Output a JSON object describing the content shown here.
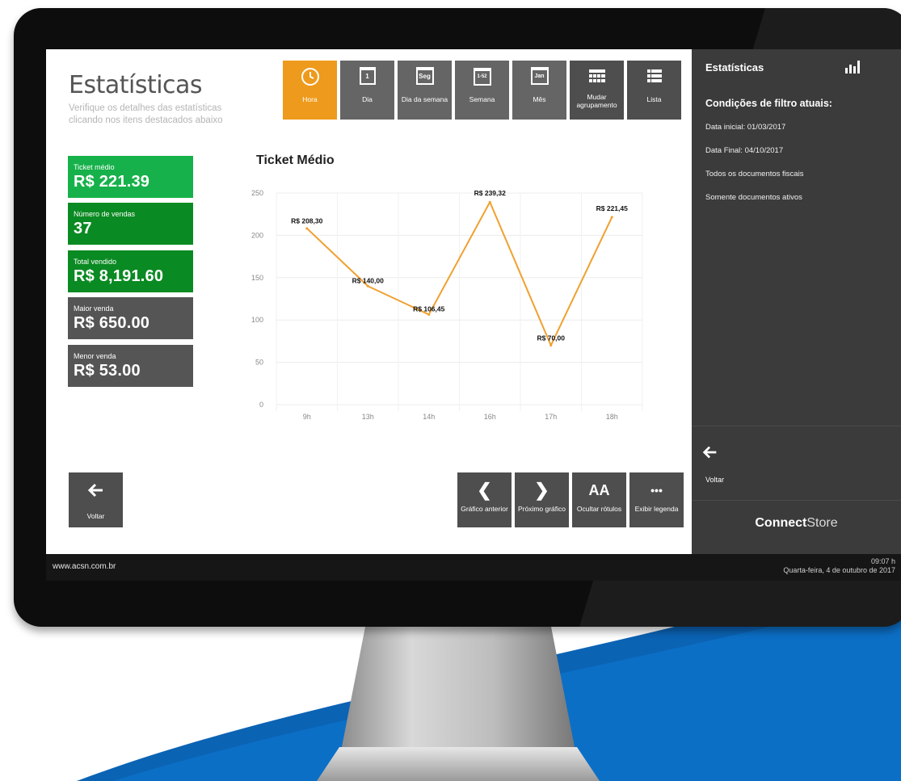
{
  "page": {
    "title": "Estatísticas",
    "subtitle": "Verifique os detalhes das estatísticas clicando nos itens destacados abaixo"
  },
  "toolbar": [
    {
      "name": "tab-hora",
      "label": "Hora",
      "icon": "clock-icon",
      "active": true
    },
    {
      "name": "tab-dia",
      "label": "Dia",
      "icon": "calendar-day-icon",
      "icon_text": "1"
    },
    {
      "name": "tab-dia-da-semana",
      "label": "Dia da semana",
      "icon": "calendar-weekday-icon",
      "icon_text": "Seg"
    },
    {
      "name": "tab-semana",
      "label": "Semana",
      "icon": "calendar-week-icon",
      "icon_text": "1-52"
    },
    {
      "name": "tab-mes",
      "label": "Mês",
      "icon": "calendar-month-icon",
      "icon_text": "Jan"
    },
    {
      "name": "mudar-agrupamento-button",
      "label": "Mudar agrupamento",
      "icon": "grid-icon"
    },
    {
      "name": "lista-button",
      "label": "Lista",
      "icon": "list-icon"
    }
  ],
  "kpis": [
    {
      "label": "Ticket médio",
      "value": "R$ 221.39",
      "color": "#16b14a"
    },
    {
      "label": "Número de vendas",
      "value": "37",
      "color": "#0a8a22"
    },
    {
      "label": "Total vendido",
      "value": "R$ 8,191.60",
      "color": "#0a8a22"
    },
    {
      "label": "Maior venda",
      "value": "R$ 650.00",
      "color": "#555555"
    },
    {
      "label": "Menor venda",
      "value": "R$ 53.00",
      "color": "#555555"
    }
  ],
  "chart_data": {
    "type": "line",
    "title": "Ticket Médio",
    "categories": [
      "9h",
      "13h",
      "14h",
      "16h",
      "17h",
      "18h"
    ],
    "values": [
      208.3,
      140.0,
      106.45,
      239.32,
      70.0,
      221.45
    ],
    "data_labels": [
      "R$ 208,30",
      "R$ 140,00",
      "R$ 106,45",
      "R$ 239,32",
      "R$ 70,00",
      "R$ 221,45"
    ],
    "y_ticks": [
      "0",
      "50",
      "100",
      "150",
      "200",
      "250"
    ],
    "ylim": [
      0,
      250
    ],
    "line_color": "#f0a030",
    "grid": true
  },
  "back_button": {
    "label": "Voltar",
    "icon": "arrow-left-icon"
  },
  "bottom_buttons": [
    {
      "name": "grafico-anterior-button",
      "label": "Gráfico anterior",
      "icon": "chevron-left-icon",
      "glyph": "❮"
    },
    {
      "name": "proximo-grafico-button",
      "label": "Próximo gráfico",
      "icon": "chevron-right-icon",
      "glyph": "❯"
    },
    {
      "name": "ocultar-rotulos-button",
      "label": "Ocultar rótulos",
      "icon": "font-size-icon",
      "glyph": "AA"
    },
    {
      "name": "exibir-legenda-button",
      "label": "Exibir legenda",
      "icon": "more-icon",
      "glyph": "•••"
    }
  ],
  "side": {
    "title": "Estatísticas",
    "icon": "bar-chart-icon",
    "filters_heading": "Condições de filtro atuais:",
    "conditions": [
      "Data inicial: 01/03/2017",
      "Data Final: 04/10/2017",
      "Todos os documentos fiscais",
      "Somente documentos ativos"
    ],
    "back_label": "Voltar",
    "brand_bold": "Connect",
    "brand_light": "Store"
  },
  "footer": {
    "url": "www.acsn.com.br",
    "time": "09:07 h",
    "date": "Quarta-feira, 4 de outubro de 2017"
  },
  "colors": {
    "accent": "#ee9a1c",
    "side_bg": "#3b3b3b",
    "footer_bg": "#161616",
    "blue": "#0b63b4"
  }
}
